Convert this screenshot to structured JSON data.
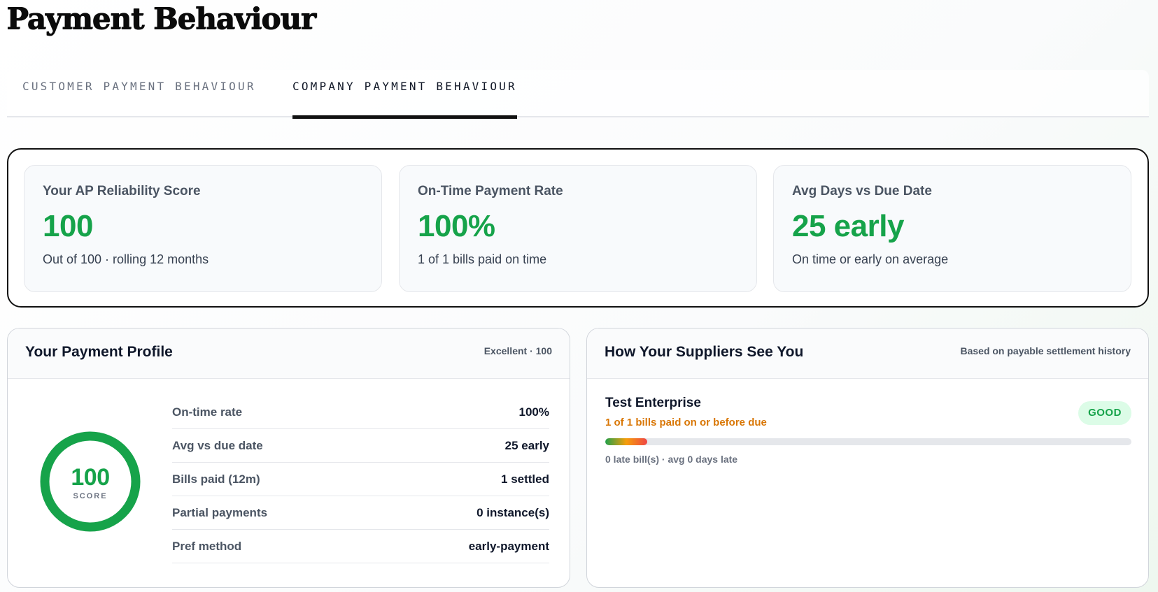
{
  "page": {
    "title": "Payment Behaviour"
  },
  "tabs": [
    {
      "label": "CUSTOMER PAYMENT BEHAVIOUR",
      "active": false
    },
    {
      "label": "COMPANY PAYMENT BEHAVIOUR",
      "active": true
    }
  ],
  "kpis": [
    {
      "label": "Your AP Reliability Score",
      "value": "100",
      "sub": "Out of 100 · rolling 12 months"
    },
    {
      "label": "On-Time Payment Rate",
      "value": "100%",
      "sub": "1 of 1 bills paid on time"
    },
    {
      "label": "Avg Days vs Due Date",
      "value": "25 early",
      "sub": "On time or early on average"
    }
  ],
  "profile": {
    "title": "Your Payment Profile",
    "meta": "Excellent · 100",
    "gauge": {
      "value": "100",
      "caption": "SCORE",
      "fraction": 1.0
    },
    "stats": [
      {
        "label": "On-time rate",
        "value": "100%"
      },
      {
        "label": "Avg vs due date",
        "value": "25 early"
      },
      {
        "label": "Bills paid (12m)",
        "value": "1 settled"
      },
      {
        "label": "Partial payments",
        "value": "0 instance(s)"
      },
      {
        "label": "Pref method",
        "value": "early-payment"
      }
    ]
  },
  "suppliers": {
    "title": "How Your Suppliers See You",
    "meta": "Based on payable settlement history",
    "items": [
      {
        "name": "Test Enterprise",
        "sub": "1 of 1 bills paid on or before due",
        "badge": "GOOD",
        "bar_fraction": 0.08,
        "foot": "0 late bill(s) · avg 0 days late"
      }
    ]
  },
  "colors": {
    "accent_green": "#16a34a",
    "warning_orange": "#d97706",
    "badge_bg": "#dcfce7"
  }
}
